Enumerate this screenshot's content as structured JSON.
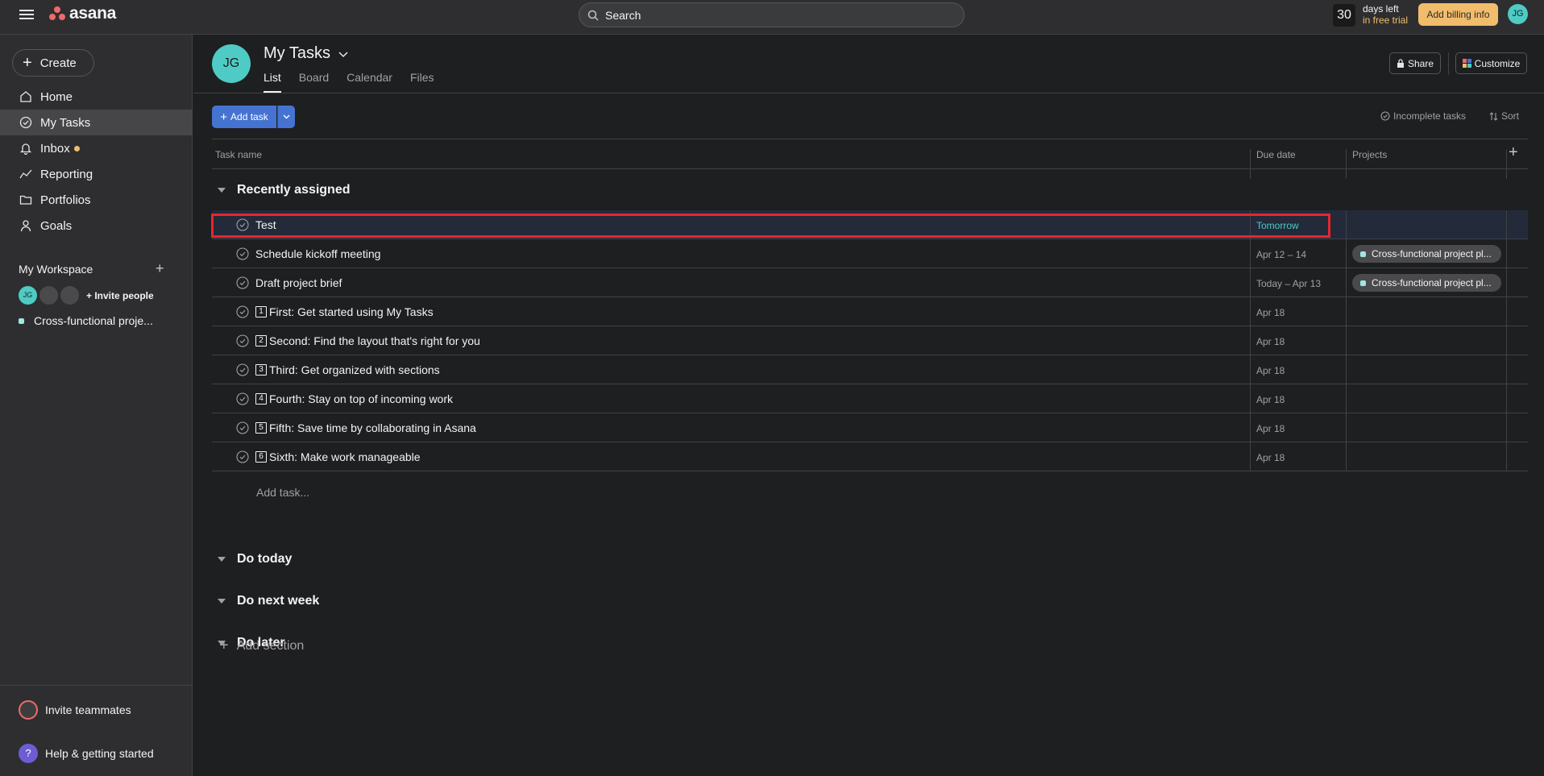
{
  "topbar": {
    "logo_text": "asana",
    "search_placeholder": "Search",
    "trial_days": "30",
    "trial_line1": "days left",
    "trial_line2": "in free trial",
    "billing_label": "Add billing info",
    "user_initials": "JG"
  },
  "sidebar": {
    "create_label": "Create",
    "nav": [
      {
        "label": "Home",
        "icon": "home-icon"
      },
      {
        "label": "My Tasks",
        "icon": "check-circle-icon",
        "active": true
      },
      {
        "label": "Inbox",
        "icon": "bell-icon",
        "has_dot": true
      },
      {
        "label": "Reporting",
        "icon": "chart-line-icon"
      },
      {
        "label": "Portfolios",
        "icon": "folder-icon"
      },
      {
        "label": "Goals",
        "icon": "person-icon"
      }
    ],
    "workspace_title": "My Workspace",
    "member_initials": "JG",
    "invite_people": "Invite people",
    "project": "Cross-functional proje...",
    "invite_teammates": "Invite teammates",
    "help": "Help & getting started"
  },
  "header": {
    "avatar_initials": "JG",
    "title": "My Tasks",
    "tabs": [
      "List",
      "Board",
      "Calendar",
      "Files"
    ],
    "active_tab": "List",
    "share": "Share",
    "customize": "Customize"
  },
  "toolbar": {
    "add_task": "Add task",
    "filter": "Incomplete tasks",
    "sort": "Sort"
  },
  "columns": {
    "task_name": "Task name",
    "due_date": "Due date",
    "projects": "Projects"
  },
  "sections": {
    "recently_assigned": "Recently assigned",
    "do_today": "Do today",
    "do_next_week": "Do next week",
    "do_later": "Do later",
    "add_section": "Add section"
  },
  "tasks": [
    {
      "num": "",
      "name": "Test",
      "due": "Tomorrow",
      "project": "",
      "selected": true
    },
    {
      "num": "",
      "name": "Schedule kickoff meeting",
      "due": "Apr 12 – 14",
      "project": "Cross-functional project pl..."
    },
    {
      "num": "",
      "name": "Draft project brief",
      "due": "Today – Apr 13",
      "project": "Cross-functional project pl..."
    },
    {
      "num": "1",
      "name": "First: Get started using My Tasks",
      "due": "Apr 18",
      "project": ""
    },
    {
      "num": "2",
      "name": "Second: Find the layout that's right for you",
      "due": "Apr 18",
      "project": ""
    },
    {
      "num": "3",
      "name": "Third: Get organized with sections",
      "due": "Apr 18",
      "project": ""
    },
    {
      "num": "4",
      "name": "Fourth: Stay on top of incoming work",
      "due": "Apr 18",
      "project": ""
    },
    {
      "num": "5",
      "name": "Fifth: Save time by collaborating in Asana",
      "due": "Apr 18",
      "project": ""
    },
    {
      "num": "6",
      "name": "Sixth: Make work manageable",
      "due": "Apr 18",
      "project": ""
    }
  ],
  "add_task_inline": "Add task...",
  "colors": {
    "accent": "#4573d2",
    "highlight": "#e8262d",
    "teal": "#4ecbc4",
    "billing": "#f1bd6c"
  }
}
